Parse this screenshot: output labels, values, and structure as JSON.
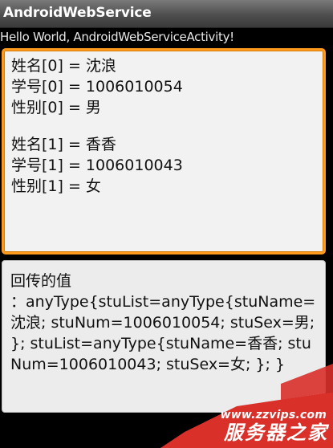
{
  "app": {
    "title": "AndroidWebService",
    "hello": "Hello World, AndroidWebServiceActivity!"
  },
  "students_input": {
    "lines": [
      "姓名[0] = 沈浪",
      "学号[0] = 1006010054",
      "性别[0] = 男",
      "",
      "姓名[1] = 香香",
      "学号[1] = 1006010043",
      "性别[1] = 女"
    ]
  },
  "result": {
    "heading": "回传的值",
    "body": "：anyType{stuList=anyType{stuName=沈浪; stuNum=1006010054; stuSex=男; }; stuList=anyType{stuName=香香; stuNum=1006010043; stuSex=女; }; }"
  },
  "watermark": {
    "url": "www.zzvips.com",
    "name": "服务器之家",
    "color": "#d9302a"
  }
}
